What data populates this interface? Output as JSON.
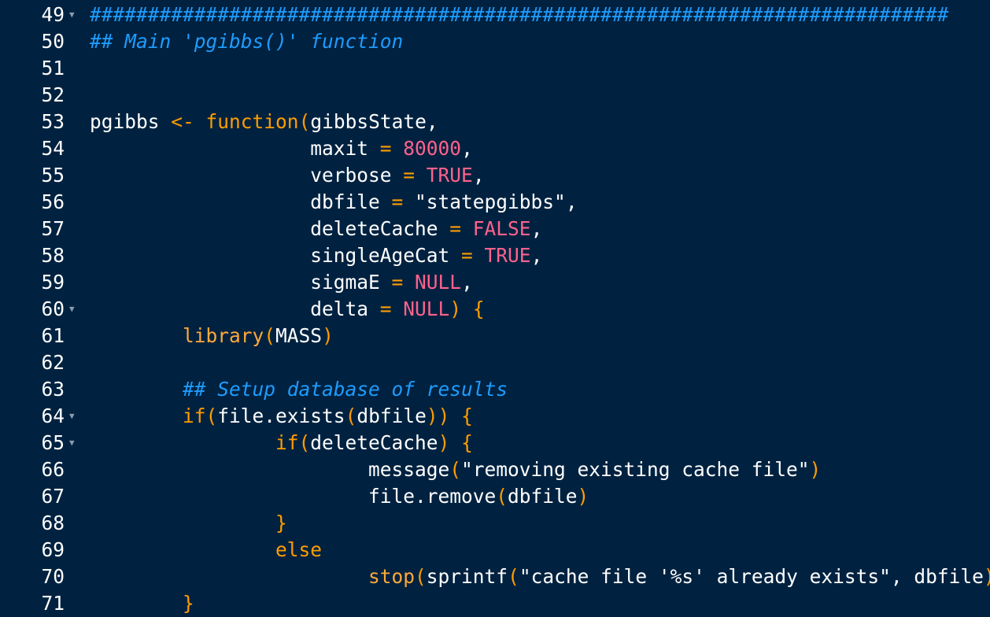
{
  "editor": {
    "theme_colors": {
      "background": "#002240",
      "comment": "#1e9cff",
      "keyword": "#ff9d00",
      "constant": "#ff628c",
      "text": "#ffffff"
    },
    "lines": [
      {
        "number": "49",
        "fold": true,
        "tokens": [
          {
            "t": "comment",
            "v": "##########################################################################"
          }
        ]
      },
      {
        "number": "50",
        "fold": false,
        "tokens": [
          {
            "t": "comment",
            "v": "## Main 'pgibbs()' function"
          }
        ]
      },
      {
        "number": "51",
        "fold": false,
        "tokens": []
      },
      {
        "number": "52",
        "fold": false,
        "tokens": []
      },
      {
        "number": "53",
        "fold": false,
        "tokens": [
          {
            "t": "id",
            "v": "pgibbs "
          },
          {
            "t": "op",
            "v": "<-"
          },
          {
            "t": "id",
            "v": " "
          },
          {
            "t": "keyword",
            "v": "function"
          },
          {
            "t": "paren",
            "v": "("
          },
          {
            "t": "id",
            "v": "gibbsState,"
          }
        ]
      },
      {
        "number": "54",
        "fold": false,
        "tokens": [
          {
            "t": "id",
            "v": "                   maxit "
          },
          {
            "t": "op",
            "v": "="
          },
          {
            "t": "id",
            "v": " "
          },
          {
            "t": "num",
            "v": "80000"
          },
          {
            "t": "punc",
            "v": ","
          }
        ]
      },
      {
        "number": "55",
        "fold": false,
        "tokens": [
          {
            "t": "id",
            "v": "                   verbose "
          },
          {
            "t": "op",
            "v": "="
          },
          {
            "t": "id",
            "v": " "
          },
          {
            "t": "const",
            "v": "TRUE"
          },
          {
            "t": "punc",
            "v": ","
          }
        ]
      },
      {
        "number": "56",
        "fold": false,
        "tokens": [
          {
            "t": "id",
            "v": "                   dbfile "
          },
          {
            "t": "op",
            "v": "="
          },
          {
            "t": "id",
            "v": " "
          },
          {
            "t": "str",
            "v": "\"statepgibbs\""
          },
          {
            "t": "punc",
            "v": ","
          }
        ]
      },
      {
        "number": "57",
        "fold": false,
        "tokens": [
          {
            "t": "id",
            "v": "                   deleteCache "
          },
          {
            "t": "op",
            "v": "="
          },
          {
            "t": "id",
            "v": " "
          },
          {
            "t": "const",
            "v": "FALSE"
          },
          {
            "t": "punc",
            "v": ","
          }
        ]
      },
      {
        "number": "58",
        "fold": false,
        "tokens": [
          {
            "t": "id",
            "v": "                   singleAgeCat "
          },
          {
            "t": "op",
            "v": "="
          },
          {
            "t": "id",
            "v": " "
          },
          {
            "t": "const",
            "v": "TRUE"
          },
          {
            "t": "punc",
            "v": ","
          }
        ]
      },
      {
        "number": "59",
        "fold": false,
        "tokens": [
          {
            "t": "id",
            "v": "                   sigmaE "
          },
          {
            "t": "op",
            "v": "="
          },
          {
            "t": "id",
            "v": " "
          },
          {
            "t": "const",
            "v": "NULL"
          },
          {
            "t": "punc",
            "v": ","
          }
        ]
      },
      {
        "number": "60",
        "fold": true,
        "tokens": [
          {
            "t": "id",
            "v": "                   delta "
          },
          {
            "t": "op",
            "v": "="
          },
          {
            "t": "id",
            "v": " "
          },
          {
            "t": "const",
            "v": "NULL"
          },
          {
            "t": "paren",
            "v": ")"
          },
          {
            "t": "id",
            "v": " "
          },
          {
            "t": "paren",
            "v": "{"
          }
        ]
      },
      {
        "number": "61",
        "fold": false,
        "tokens": [
          {
            "t": "id",
            "v": "        "
          },
          {
            "t": "fn",
            "v": "library"
          },
          {
            "t": "paren",
            "v": "("
          },
          {
            "t": "id",
            "v": "MASS"
          },
          {
            "t": "paren",
            "v": ")"
          }
        ]
      },
      {
        "number": "62",
        "fold": false,
        "tokens": []
      },
      {
        "number": "63",
        "fold": false,
        "tokens": [
          {
            "t": "id",
            "v": "        "
          },
          {
            "t": "comment",
            "v": "## Setup database of results"
          }
        ]
      },
      {
        "number": "64",
        "fold": true,
        "tokens": [
          {
            "t": "id",
            "v": "        "
          },
          {
            "t": "keyword",
            "v": "if"
          },
          {
            "t": "paren",
            "v": "("
          },
          {
            "t": "id",
            "v": "file.exists"
          },
          {
            "t": "paren",
            "v": "("
          },
          {
            "t": "id",
            "v": "dbfile"
          },
          {
            "t": "paren",
            "v": "))"
          },
          {
            "t": "id",
            "v": " "
          },
          {
            "t": "paren",
            "v": "{"
          }
        ]
      },
      {
        "number": "65",
        "fold": true,
        "tokens": [
          {
            "t": "id",
            "v": "                "
          },
          {
            "t": "keyword",
            "v": "if"
          },
          {
            "t": "paren",
            "v": "("
          },
          {
            "t": "id",
            "v": "deleteCache"
          },
          {
            "t": "paren",
            "v": ")"
          },
          {
            "t": "id",
            "v": " "
          },
          {
            "t": "paren",
            "v": "{"
          }
        ]
      },
      {
        "number": "66",
        "fold": false,
        "tokens": [
          {
            "t": "id",
            "v": "                        message"
          },
          {
            "t": "paren",
            "v": "("
          },
          {
            "t": "str",
            "v": "\"removing existing cache file\""
          },
          {
            "t": "paren",
            "v": ")"
          }
        ]
      },
      {
        "number": "67",
        "fold": false,
        "tokens": [
          {
            "t": "id",
            "v": "                        file.remove"
          },
          {
            "t": "paren",
            "v": "("
          },
          {
            "t": "id",
            "v": "dbfile"
          },
          {
            "t": "paren",
            "v": ")"
          }
        ]
      },
      {
        "number": "68",
        "fold": false,
        "tokens": [
          {
            "t": "id",
            "v": "                "
          },
          {
            "t": "paren",
            "v": "}"
          }
        ]
      },
      {
        "number": "69",
        "fold": false,
        "tokens": [
          {
            "t": "id",
            "v": "                "
          },
          {
            "t": "keyword",
            "v": "else"
          }
        ]
      },
      {
        "number": "70",
        "fold": false,
        "tokens": [
          {
            "t": "id",
            "v": "                        "
          },
          {
            "t": "fn",
            "v": "stop"
          },
          {
            "t": "paren",
            "v": "("
          },
          {
            "t": "id",
            "v": "sprintf"
          },
          {
            "t": "paren",
            "v": "("
          },
          {
            "t": "str",
            "v": "\"cache file '%s' already exists\""
          },
          {
            "t": "punc",
            "v": ", "
          },
          {
            "t": "id",
            "v": "dbfile"
          },
          {
            "t": "paren",
            "v": "))"
          }
        ]
      },
      {
        "number": "71",
        "fold": false,
        "tokens": [
          {
            "t": "id",
            "v": "        "
          },
          {
            "t": "paren",
            "v": "}"
          }
        ]
      }
    ]
  }
}
